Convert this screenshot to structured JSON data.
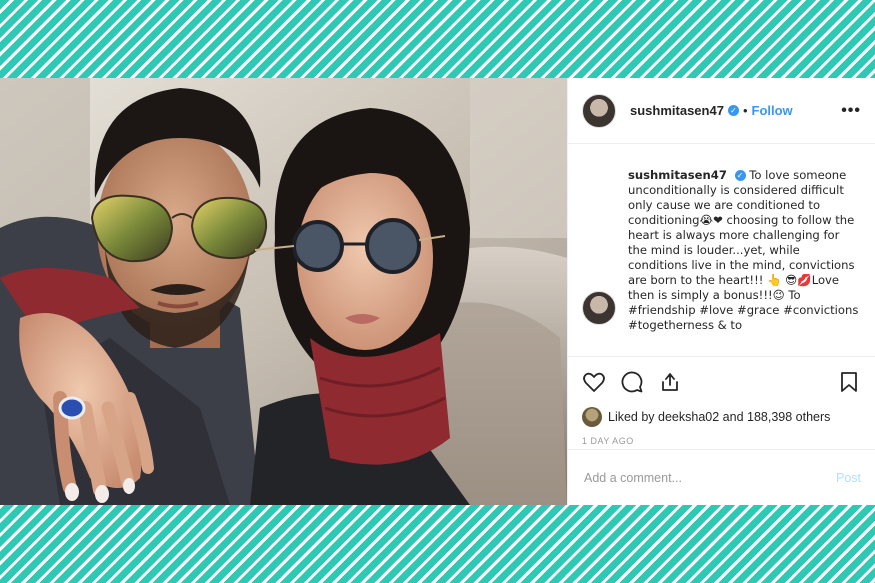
{
  "header": {
    "username": "sushmitasen47",
    "verified_icon": "verified-badge-icon",
    "separator": "•",
    "follow_label": "Follow",
    "more_label": "•••"
  },
  "caption": {
    "username": "sushmitasen47",
    "text": "To love someone unconditionally is considered difficult only cause we are conditioned to conditioning😭❤ choosing to follow the heart is always more challenging for the mind is louder...yet, while conditions live in the mind, convictions are born to the heart!!! 👆 😎💋Love then is simply a bonus!!!😉 To #friendship #love #grace #convictions #togetherness & to"
  },
  "actions": {
    "like_icon": "heart-icon",
    "comment_icon": "comment-icon",
    "share_icon": "share-icon",
    "save_icon": "bookmark-icon"
  },
  "likes": {
    "text": "Liked by deeksha02 and 188,398 others"
  },
  "timestamp": "1 DAY AGO",
  "comment": {
    "placeholder": "Add a comment...",
    "post_label": "Post"
  },
  "colors": {
    "accent": "#3897f0",
    "frame_stripe": "#2ec9b4",
    "post_disabled": "#b2dffc"
  }
}
